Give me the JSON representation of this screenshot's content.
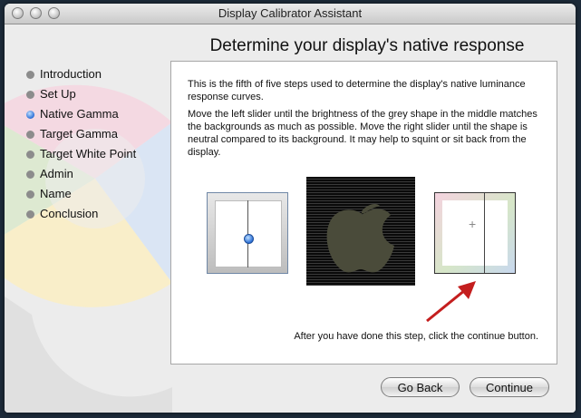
{
  "window": {
    "title": "Display Calibrator Assistant"
  },
  "page": {
    "heading": "Determine your display's native response"
  },
  "steps": [
    {
      "label": "Introduction",
      "state": "done"
    },
    {
      "label": "Set Up",
      "state": "done"
    },
    {
      "label": "Native Gamma",
      "state": "current"
    },
    {
      "label": "Target Gamma",
      "state": "pending"
    },
    {
      "label": "Target White Point",
      "state": "pending"
    },
    {
      "label": "Admin",
      "state": "pending"
    },
    {
      "label": "Name",
      "state": "pending"
    },
    {
      "label": "Conclusion",
      "state": "pending"
    }
  ],
  "panel": {
    "paragraph1": "This is the fifth of five steps used to determine the display's native luminance response curves.",
    "paragraph2": "Move the left slider until the brightness of the grey shape in the middle matches the backgrounds as much as possible.  Move the right slider until the shape is neutral compared to its background.  It may help to squint or sit back from the display.",
    "footer": "After you have done this step, click the continue button."
  },
  "buttons": {
    "back": "Go Back",
    "continue": "Continue"
  },
  "colors": {
    "accent": "#2b6fd6",
    "arrow": "#c41e1e",
    "apple_fill": "#4a4b3a"
  },
  "icons": [
    "apple-logo-icon",
    "step-dot-icon",
    "arrow-icon"
  ]
}
